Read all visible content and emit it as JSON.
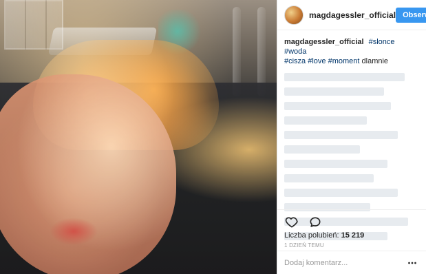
{
  "post": {
    "author": {
      "username": "magdagessler_official"
    },
    "follow_button": "Obserwuj",
    "caption": {
      "username": "magdagessler_official",
      "hashtags": [
        "#slonce",
        "#woda",
        "#cisza",
        "#love",
        "#moment"
      ],
      "text_suffix": "dlamnie"
    },
    "likes": {
      "label": "Liczba polubień:",
      "count": "15 219"
    },
    "time_ago": "1 DZIEŃ TEMU",
    "comment": {
      "placeholder": "Dodaj komentarz..."
    },
    "icons": {
      "like": "heart-outline",
      "comment": "speech-bubble-outline",
      "more": "more-dots"
    },
    "colors": {
      "follow_bg": "#3897f0",
      "hashtag": "#003569",
      "border": "#efefef"
    }
  }
}
